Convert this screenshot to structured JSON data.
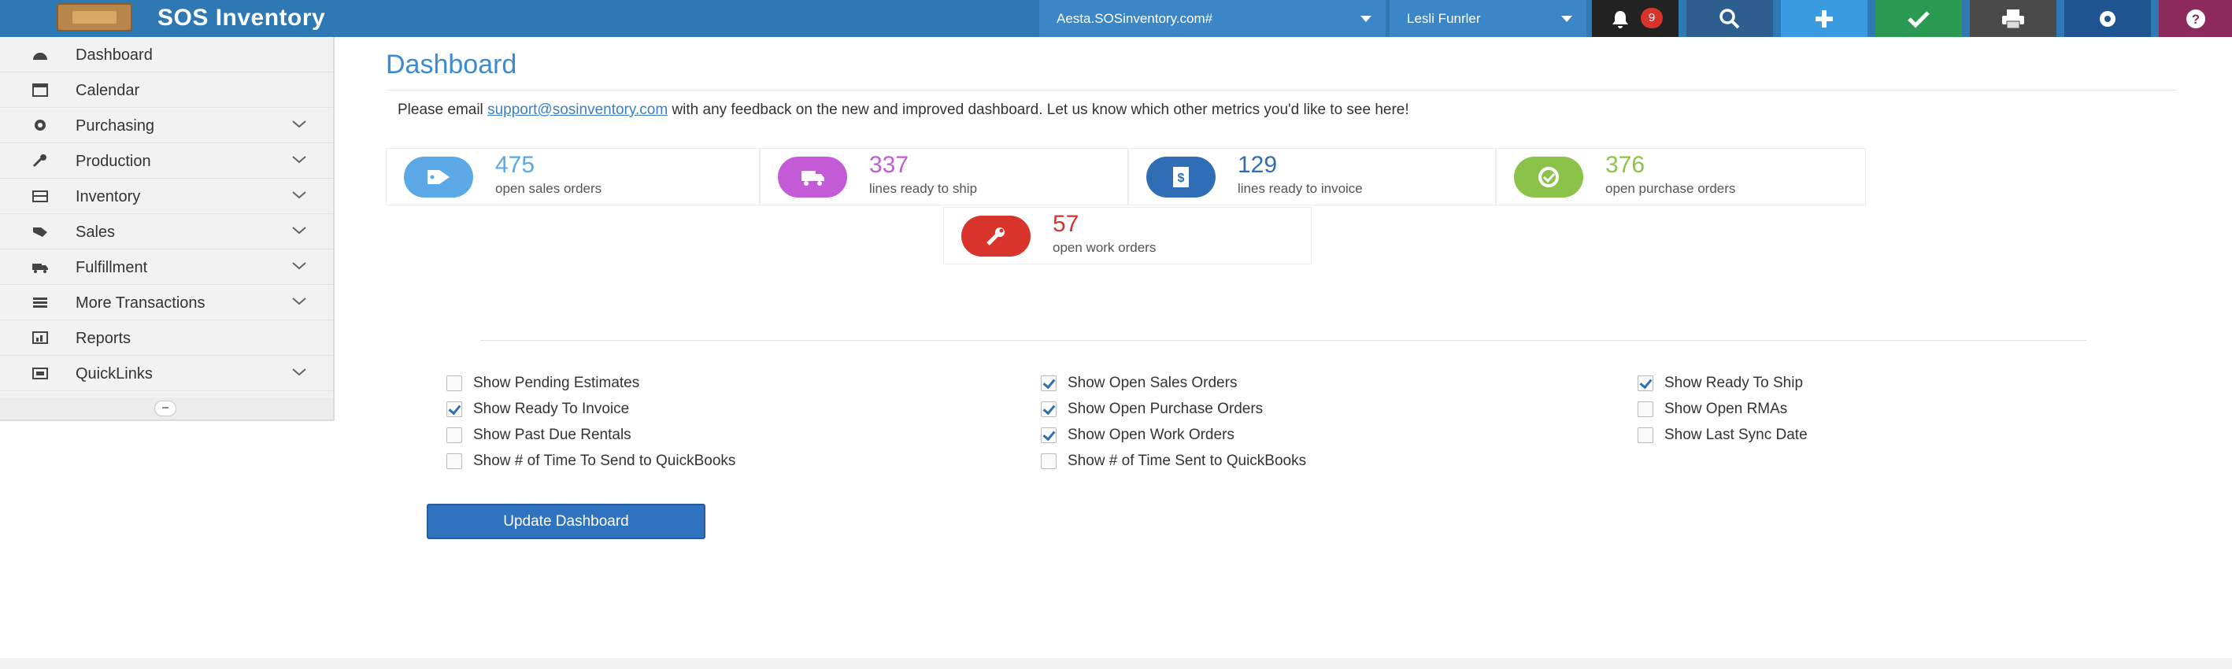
{
  "app": {
    "title": "SOS Inventory"
  },
  "topbar": {
    "user_dropdown": "Aesta.SOSinventory.com#",
    "location_dropdown": "Lesli Funrler",
    "notification_count": "9",
    "colors": {
      "bar": "#2e78b4",
      "search": "#2c5e8e",
      "add": "#3b9be0",
      "check": "#2a9a52",
      "print": "#4a4a4a",
      "settings": "#1e5590",
      "help": "#8c2a5e",
      "notify": "#222222"
    }
  },
  "sidebar": {
    "items": [
      {
        "label": "Dashboard",
        "icon": "dashboard-icon",
        "has_children": false
      },
      {
        "label": "Calendar",
        "icon": "calendar-icon",
        "has_children": false
      },
      {
        "label": "Purchasing",
        "icon": "purchasing-icon",
        "has_children": true
      },
      {
        "label": "Production",
        "icon": "wrench-icon",
        "has_children": true
      },
      {
        "label": "Inventory",
        "icon": "inventory-icon",
        "has_children": true
      },
      {
        "label": "Sales",
        "icon": "sales-icon",
        "has_children": true
      },
      {
        "label": "Fulfillment",
        "icon": "truck-icon",
        "has_children": true
      },
      {
        "label": "More Transactions",
        "icon": "list-icon",
        "has_children": true
      },
      {
        "label": "Reports",
        "icon": "reports-icon",
        "has_children": false
      },
      {
        "label": "QuickLinks",
        "icon": "quicklinks-icon",
        "has_children": true
      }
    ]
  },
  "main": {
    "title": "Dashboard",
    "notice_prefix": "Please email ",
    "notice_link": "support@sosinventory.com",
    "notice_suffix": " with any feedback on the new and improved dashboard. Let us know which other metrics you'd like to see here!",
    "cards": [
      {
        "value": "475",
        "label": "open sales orders",
        "color": "#5aa9e6",
        "icon": "tag-icon"
      },
      {
        "value": "337",
        "label": "lines ready to ship",
        "color": "#c35bd6",
        "icon": "truck-icon"
      },
      {
        "value": "129",
        "label": "lines ready to invoice",
        "color": "#2f6eb5",
        "icon": "invoice-icon"
      },
      {
        "value": "376",
        "label": "open purchase orders",
        "color": "#8bc34a",
        "icon": "cart-icon"
      },
      {
        "value": "57",
        "label": "open work orders",
        "color": "#d9342b",
        "icon": "wrench-icon"
      }
    ],
    "options": [
      {
        "label": "Show Pending Estimates",
        "checked": false
      },
      {
        "label": "Show Ready To Invoice",
        "checked": true
      },
      {
        "label": "Show Past Due Rentals",
        "checked": false
      },
      {
        "label": "Show # of Time To Send to QuickBooks",
        "checked": false
      },
      {
        "label": "Show Open Sales Orders",
        "checked": true
      },
      {
        "label": "Show Open Purchase Orders",
        "checked": true
      },
      {
        "label": "Show Open Work Orders",
        "checked": true
      },
      {
        "label": "Show # of Time Sent to QuickBooks",
        "checked": false
      },
      {
        "label": "Show Ready To Ship",
        "checked": true
      },
      {
        "label": "Show Open RMAs",
        "checked": false
      },
      {
        "label": "Show Last Sync Date",
        "checked": false
      }
    ],
    "update_button": "Update Dashboard"
  }
}
